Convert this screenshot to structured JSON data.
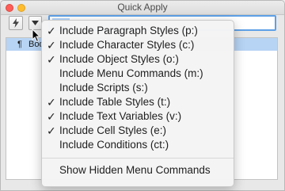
{
  "window": {
    "title": "Quick Apply"
  },
  "toolbar": {
    "bolt_icon": "lightning-icon",
    "menu_icon": "chevron-down-icon"
  },
  "search": {
    "value": ""
  },
  "results": [
    {
      "icon": "paragraph-icon",
      "symbol": "¶",
      "label": "Bod"
    }
  ],
  "menu": {
    "items": [
      {
        "label": "Include Paragraph Styles (p:)",
        "checked": true
      },
      {
        "label": "Include Character Styles (c:)",
        "checked": true
      },
      {
        "label": "Include Object Styles (o:)",
        "checked": true
      },
      {
        "label": "Include Menu Commands (m:)",
        "checked": false
      },
      {
        "label": "Include Scripts (s:)",
        "checked": false
      },
      {
        "label": "Include Table Styles (t:)",
        "checked": true
      },
      {
        "label": "Include Text Variables (v:)",
        "checked": true
      },
      {
        "label": "Include Cell Styles (e:)",
        "checked": true
      },
      {
        "label": "Include Conditions (ct:)",
        "checked": false
      }
    ],
    "footer_item": "Show Hidden Menu Commands"
  }
}
